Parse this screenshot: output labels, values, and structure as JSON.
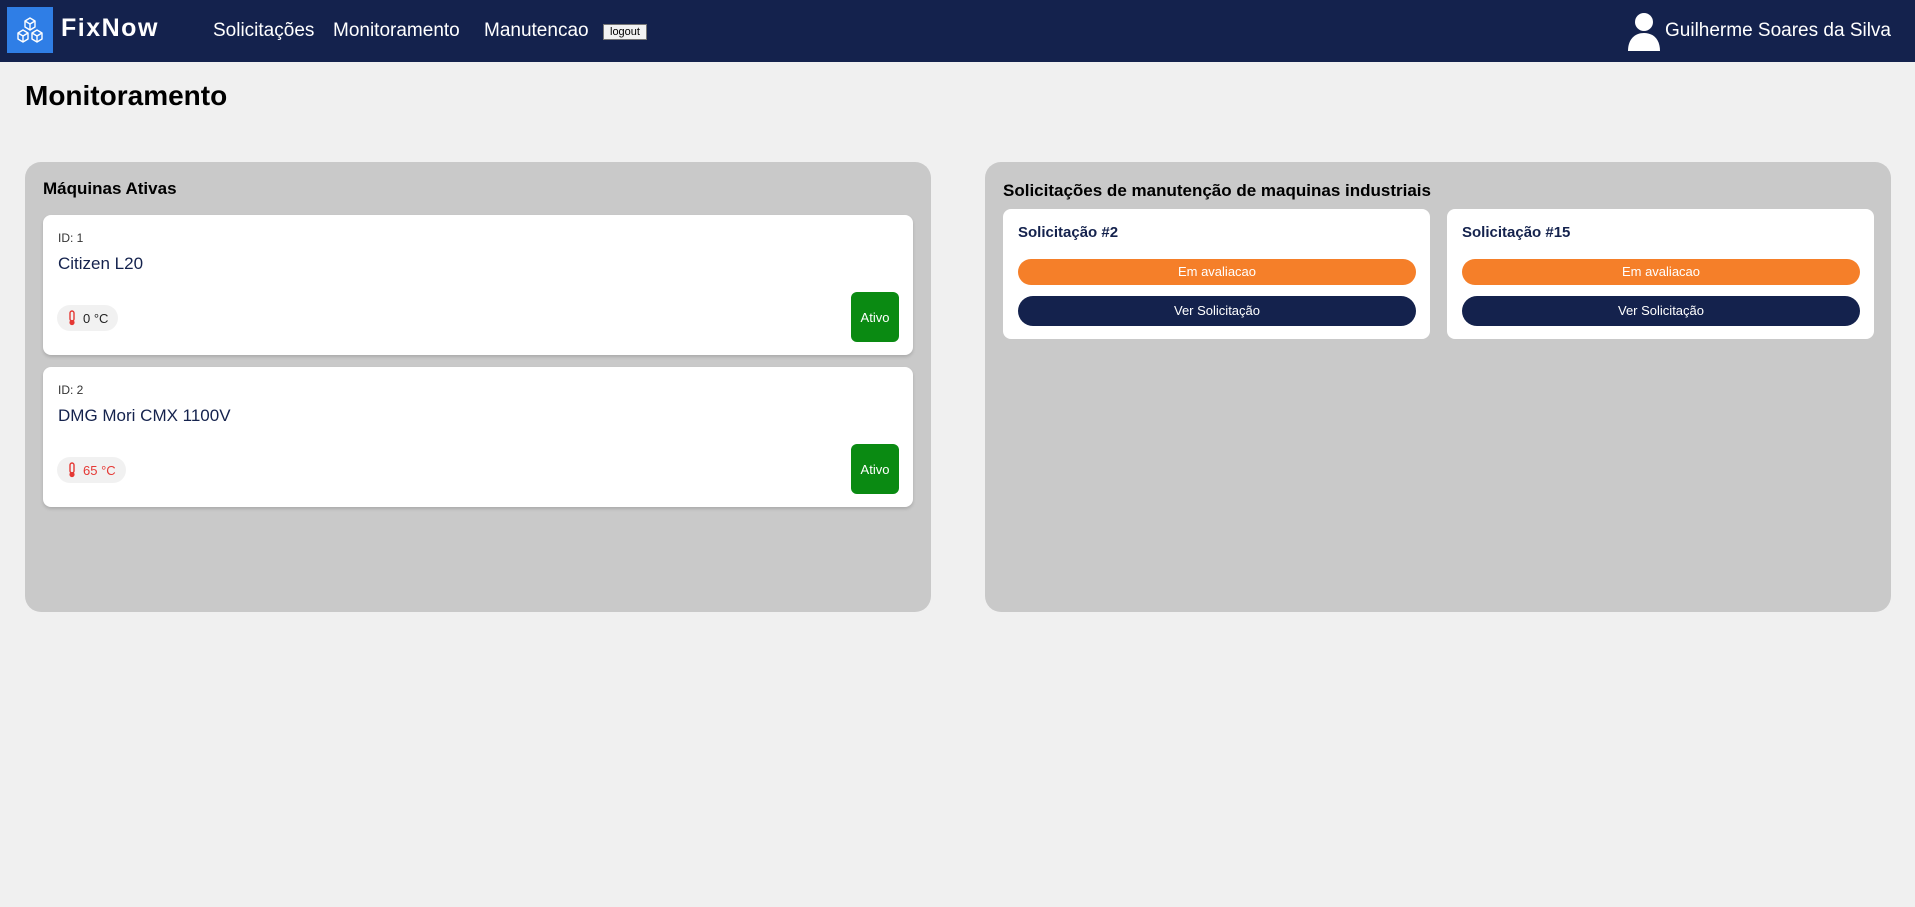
{
  "app": {
    "brand": "FixNow",
    "logo_icon": "cubes-icon",
    "brand_color": "#14224d",
    "logo_color": "#2f7ee6"
  },
  "nav": {
    "items": [
      {
        "label": "Solicitações"
      },
      {
        "label": "Monitoramento"
      },
      {
        "label": "Manutencao"
      }
    ],
    "logout_label": "logout"
  },
  "user": {
    "name": "Guilherme Soares da Silva",
    "icon": "user-icon"
  },
  "page": {
    "title": "Monitoramento"
  },
  "machines_panel": {
    "title": "Máquinas Ativas",
    "machines": [
      {
        "id_label": "ID: 1",
        "name": "Citizen L20",
        "temperature": "0 °C",
        "temp_color": "#222222",
        "status": "Ativo"
      },
      {
        "id_label": "ID: 2",
        "name": "DMG Mori CMX 1100V",
        "temperature": "65 °C",
        "temp_color": "#e53935",
        "status": "Ativo"
      }
    ],
    "status_color": "#0a8a12"
  },
  "requests_panel": {
    "title": "Solicitações de manutenção de maquinas industriais",
    "requests": [
      {
        "title": "Solicitação #2",
        "status": "Em avaliacao",
        "button": "Ver Solicitação"
      },
      {
        "title": "Solicitação #15",
        "status": "Em avaliacao",
        "button": "Ver Solicitação"
      }
    ],
    "status_color": "#f57f29"
  }
}
